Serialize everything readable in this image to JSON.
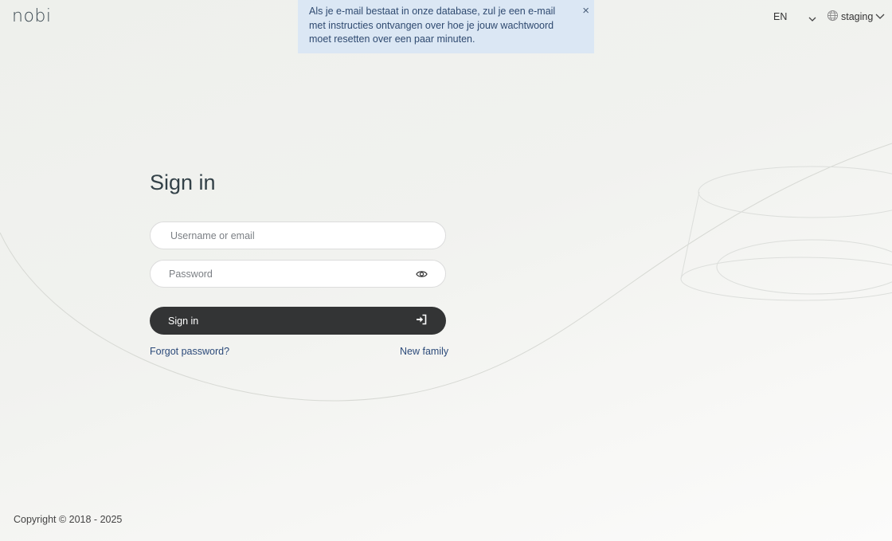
{
  "header": {
    "logo_text": "nobi",
    "language": "EN",
    "environment": "staging"
  },
  "toast": {
    "message": "Als je e-mail bestaat in onze database, zul je een e-mail met instructies ontvangen over hoe je jouw wachtwoord moet resetten over een paar minuten.",
    "close_glyph": "×"
  },
  "form": {
    "title": "Sign in",
    "username_placeholder": "Username or email",
    "username_value": "",
    "password_placeholder": "Password",
    "password_value": "",
    "submit_label": "Sign in",
    "forgot_label": "Forgot password?",
    "new_family_label": "New family"
  },
  "footer": {
    "copyright": "Copyright © 2018 - 2025"
  },
  "colors": {
    "toast_bg": "#dbe7f4",
    "button_bg": "#333435",
    "link": "#2c4a7a"
  },
  "icons": {
    "password_toggle": "eye-icon",
    "submit": "sign-in-arrow-icon",
    "environment": "globe-icon",
    "dropdown": "chevron-down-icon",
    "close": "close-icon"
  }
}
